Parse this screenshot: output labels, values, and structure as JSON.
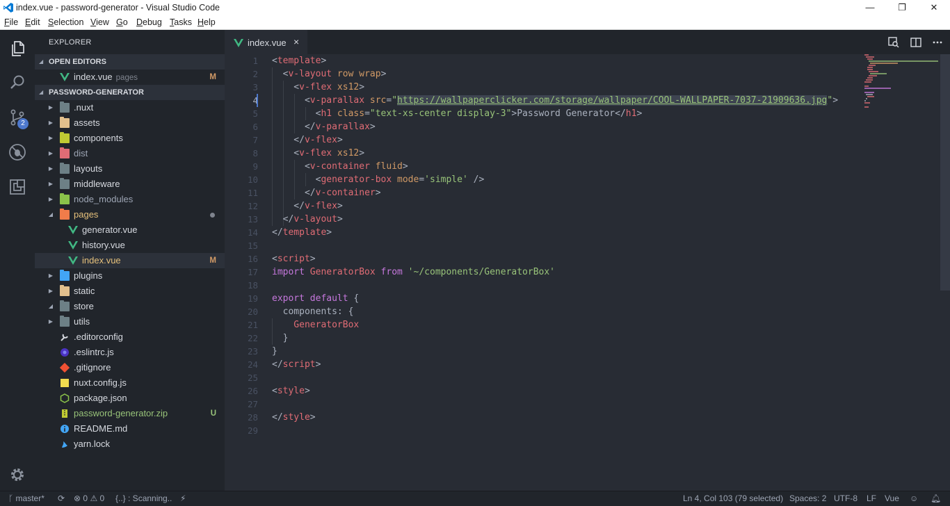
{
  "window": {
    "title": "index.vue - password-generator - Visual Studio Code",
    "controls": {
      "minimize": "—",
      "maximize": "❐",
      "close": "✕"
    }
  },
  "menu": [
    "File",
    "Edit",
    "Selection",
    "View",
    "Go",
    "Debug",
    "Tasks",
    "Help"
  ],
  "activity": {
    "icons": [
      "files-icon",
      "search-icon",
      "source-control-icon",
      "debug-icon",
      "extensions-icon",
      "settings-gear-icon"
    ],
    "scm_badge": "2"
  },
  "sidebar": {
    "title": "EXPLORER",
    "open_editors": {
      "label": "OPEN EDITORS",
      "items": [
        {
          "name": "index.vue",
          "desc": "pages",
          "status": "M"
        }
      ]
    },
    "project": {
      "label": "PASSWORD-GENERATOR",
      "items": [
        {
          "name": ".nuxt",
          "kind": "folder",
          "color": "#6d8086"
        },
        {
          "name": "assets",
          "kind": "folder",
          "color": "#e2c08d"
        },
        {
          "name": "components",
          "kind": "folder",
          "color": "#c0ca33"
        },
        {
          "name": "dist",
          "kind": "folder",
          "color": "#e06c75"
        },
        {
          "name": "layouts",
          "kind": "folder",
          "color": "#6d8086"
        },
        {
          "name": "middleware",
          "kind": "folder",
          "color": "#6d8086"
        },
        {
          "name": "node_modules",
          "kind": "folder",
          "color": "#8bc34a"
        },
        {
          "name": "pages",
          "kind": "folder-open",
          "color": "#f07c4a"
        },
        {
          "name": "generator.vue",
          "kind": "vue"
        },
        {
          "name": "history.vue",
          "kind": "vue"
        },
        {
          "name": "index.vue",
          "kind": "vue",
          "status": "M"
        },
        {
          "name": "plugins",
          "kind": "folder",
          "color": "#42a5f5"
        },
        {
          "name": "static",
          "kind": "folder",
          "color": "#e2c08d"
        },
        {
          "name": "store",
          "kind": "folder-open",
          "color": "#6d8086"
        },
        {
          "name": "utils",
          "kind": "folder",
          "color": "#6d8086"
        },
        {
          "name": ".editorconfig",
          "kind": "file"
        },
        {
          "name": ".eslintrc.js",
          "kind": "file"
        },
        {
          "name": ".gitignore",
          "kind": "file"
        },
        {
          "name": "nuxt.config.js",
          "kind": "file"
        },
        {
          "name": "package.json",
          "kind": "file"
        },
        {
          "name": "password-generator.zip",
          "kind": "file",
          "status": "U"
        },
        {
          "name": "README.md",
          "kind": "file"
        },
        {
          "name": "yarn.lock",
          "kind": "file"
        }
      ]
    }
  },
  "tabs": [
    {
      "label": "index.vue",
      "close": "×"
    }
  ],
  "editor": {
    "line_numbers": [
      "1",
      "2",
      "3",
      "4",
      "5",
      "6",
      "7",
      "8",
      "9",
      "10",
      "11",
      "12",
      "13",
      "14",
      "15",
      "16",
      "17",
      "18",
      "19",
      "20",
      "21",
      "22",
      "23",
      "24",
      "25",
      "26",
      "27",
      "28",
      "29"
    ],
    "lines": [
      [
        [
          "t-p",
          "<"
        ],
        [
          "t-tag",
          "template"
        ],
        [
          "t-p",
          ">"
        ]
      ],
      [
        [
          "t-p",
          "  <"
        ],
        [
          "t-tag",
          "v-layout"
        ],
        [
          "t-attr",
          " row wrap"
        ],
        [
          "t-p",
          ">"
        ]
      ],
      [
        [
          "t-p",
          "    <"
        ],
        [
          "t-tag",
          "v-flex"
        ],
        [
          "t-attr",
          " xs12"
        ],
        [
          "t-p",
          ">"
        ]
      ],
      [
        [
          "t-p",
          "      <"
        ],
        [
          "t-tag",
          "v-parallax"
        ],
        [
          "t-attr",
          " src"
        ],
        [
          "t-p",
          "="
        ],
        [
          "t-str",
          "\""
        ],
        [
          "t-url",
          "https://wallpaperclicker.com/storage/wallpaper/COOL-WALLPAPER-7037-21909636.jpg"
        ],
        [
          "t-str",
          "\""
        ],
        [
          "t-p",
          ">"
        ]
      ],
      [
        [
          "t-p",
          "        <"
        ],
        [
          "t-tag",
          "h1"
        ],
        [
          "t-attr",
          " class"
        ],
        [
          "t-p",
          "="
        ],
        [
          "t-str",
          "\"text-xs-center display-3\""
        ],
        [
          "t-p",
          ">Password Generator</"
        ],
        [
          "t-tag",
          "h1"
        ],
        [
          "t-p",
          ">"
        ]
      ],
      [
        [
          "t-p",
          "      </"
        ],
        [
          "t-tag",
          "v-parallax"
        ],
        [
          "t-p",
          ">"
        ]
      ],
      [
        [
          "t-p",
          "    </"
        ],
        [
          "t-tag",
          "v-flex"
        ],
        [
          "t-p",
          ">"
        ]
      ],
      [
        [
          "t-p",
          "    <"
        ],
        [
          "t-tag",
          "v-flex"
        ],
        [
          "t-attr",
          " xs12"
        ],
        [
          "t-p",
          ">"
        ]
      ],
      [
        [
          "t-p",
          "      <"
        ],
        [
          "t-tag",
          "v-container"
        ],
        [
          "t-attr",
          " fluid"
        ],
        [
          "t-p",
          ">"
        ]
      ],
      [
        [
          "t-p",
          "        <"
        ],
        [
          "t-tag",
          "generator-box"
        ],
        [
          "t-attr",
          " mode"
        ],
        [
          "t-p",
          "="
        ],
        [
          "t-str",
          "'simple'"
        ],
        [
          "t-p",
          " />"
        ]
      ],
      [
        [
          "t-p",
          "      </"
        ],
        [
          "t-tag",
          "v-container"
        ],
        [
          "t-p",
          ">"
        ]
      ],
      [
        [
          "t-p",
          "    </"
        ],
        [
          "t-tag",
          "v-flex"
        ],
        [
          "t-p",
          ">"
        ]
      ],
      [
        [
          "t-p",
          "  </"
        ],
        [
          "t-tag",
          "v-layout"
        ],
        [
          "t-p",
          ">"
        ]
      ],
      [
        [
          "t-p",
          "</"
        ],
        [
          "t-tag",
          "template"
        ],
        [
          "t-p",
          ">"
        ]
      ],
      [],
      [
        [
          "t-p",
          "<"
        ],
        [
          "t-tag",
          "script"
        ],
        [
          "t-p",
          ">"
        ]
      ],
      [
        [
          "t-kw",
          "import"
        ],
        [
          "t-var",
          " GeneratorBox"
        ],
        [
          "t-kw",
          " from"
        ],
        [
          "t-str",
          " '~/components/GeneratorBox'"
        ]
      ],
      [],
      [
        [
          "t-kw",
          "export"
        ],
        [
          "t-kw",
          " default"
        ],
        [
          "t-p",
          " {"
        ]
      ],
      [
        [
          "t-p",
          "  components: {"
        ]
      ],
      [
        [
          "t-var",
          "    GeneratorBox"
        ]
      ],
      [
        [
          "t-p",
          "  }"
        ]
      ],
      [
        [
          "t-p",
          "}"
        ]
      ],
      [
        [
          "t-p",
          "</"
        ],
        [
          "t-tag",
          "script"
        ],
        [
          "t-p",
          ">"
        ]
      ],
      [],
      [
        [
          "t-p",
          "<"
        ],
        [
          "t-tag",
          "style"
        ],
        [
          "t-p",
          ">"
        ]
      ],
      [],
      [
        [
          "t-p",
          "</"
        ],
        [
          "t-tag",
          "style"
        ],
        [
          "t-p",
          ">"
        ]
      ],
      []
    ]
  },
  "status": {
    "branch": "master*",
    "errors": "0",
    "warnings": "0",
    "task": "{..} : Scanning..",
    "position": "Ln 4, Col 103 (79 selected)",
    "spaces": "Spaces: 2",
    "encoding": "UTF-8",
    "eol": "LF",
    "language": "Vue"
  },
  "colors": {
    "vue_green": "#41b883",
    "modified": "#d19a66",
    "untracked": "#98c379",
    "accent": "#4d78cc"
  }
}
